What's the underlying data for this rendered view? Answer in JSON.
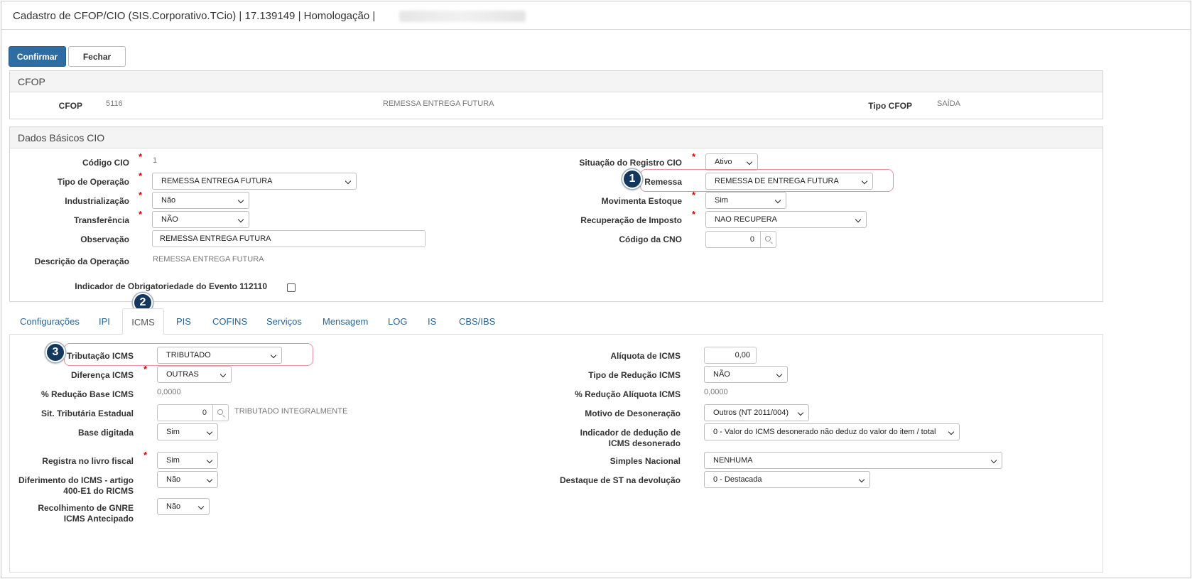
{
  "window": {
    "title": "Cadastro de CFOP/CIO (SIS.Corporativo.TCio) | 17.139149 | Homologação |"
  },
  "toolbar": {
    "confirm_label": "Confirmar",
    "close_label": "Fechar"
  },
  "cfop": {
    "heading": "CFOP",
    "cfop_label": "CFOP",
    "cfop_code": "5116",
    "cfop_desc": "REMESSA ENTREGA FUTURA",
    "tipo_label": "Tipo CFOP",
    "tipo_value": "SAÍDA"
  },
  "basic": {
    "heading": "Dados Básicos CIO",
    "codigo_label": "Código CIO",
    "codigo_value": "1",
    "tipo_op_label": "Tipo de Operação",
    "tipo_op_value": "REMESSA ENTREGA FUTURA",
    "industrializacao_label": "Industrialização",
    "industrializacao_value": "Não",
    "transferencia_label": "Transferência",
    "transferencia_value": "NÃO",
    "observacao_label": "Observação",
    "observacao_value": "REMESSA ENTREGA FUTURA",
    "descricao_label": "Descrição da Operação",
    "descricao_value": "REMESSA ENTREGA FUTURA",
    "indicador_label": "Indicador de Obrigatoriedade do Evento 112110",
    "situacao_label": "Situação do Registro CIO",
    "situacao_value": "Ativo",
    "remessa_label": "Remessa",
    "remessa_value": "REMESSA DE ENTREGA FUTURA",
    "movimenta_label": "Movimenta Estoque",
    "movimenta_value": "Sim",
    "recuperacao_label": "Recuperação de Imposto",
    "recuperacao_value": "NAO RECUPERA",
    "cno_label": "Código da CNO",
    "cno_value": "0"
  },
  "badges": {
    "b1": "1",
    "b2": "2",
    "b3": "3"
  },
  "tabs": [
    {
      "label": "Configurações"
    },
    {
      "label": "IPI"
    },
    {
      "label": "ICMS"
    },
    {
      "label": "PIS"
    },
    {
      "label": "COFINS"
    },
    {
      "label": "Serviços"
    },
    {
      "label": "Mensagem"
    },
    {
      "label": "LOG"
    },
    {
      "label": "IS"
    },
    {
      "label": "CBS/IBS"
    }
  ],
  "icms": {
    "tributacao_label": "Tributação ICMS",
    "tributacao_value": "TRIBUTADO",
    "diferenca_label": "Diferença ICMS",
    "diferenca_value": "OUTRAS",
    "reducao_base_label": "% Redução Base ICMS",
    "reducao_base_value": "0,0000",
    "sit_trib_label": "Sit. Tributária Estadual",
    "sit_trib_value": "0",
    "sit_trib_desc": "TRIBUTADO INTEGRALMENTE",
    "base_digitada_label": "Base digitada",
    "base_digitada_value": "Sim",
    "registra_label": "Registra no livro fiscal",
    "registra_value": "Sim",
    "diferimento_label": "Diferimento do ICMS - artigo 400-E1 do RICMS",
    "diferimento_value": "Não",
    "gnre_label": "Recolhimento de GNRE ICMS Antecipado",
    "gnre_value": "Não",
    "aliquota_label": "Alíquota de ICMS",
    "aliquota_value": "0,00",
    "tipo_reducao_label": "Tipo de Redução ICMS",
    "tipo_reducao_value": "NÃO",
    "reducao_aliq_label": "% Redução Alíquota ICMS",
    "reducao_aliq_value": "0,0000",
    "motivo_label": "Motivo de Desoneração",
    "motivo_value": "Outros (NT 2011/004)",
    "ind_deducao_label": "Indicador de dedução de ICMS desonerado",
    "ind_deducao_value": "0 - Valor do ICMS desonerado não deduz do valor do item / total",
    "simples_label": "Simples Nacional",
    "simples_value": "NENHUMA",
    "destaque_label": "Destaque de ST na devolução",
    "destaque_value": "0 - Destacada"
  }
}
